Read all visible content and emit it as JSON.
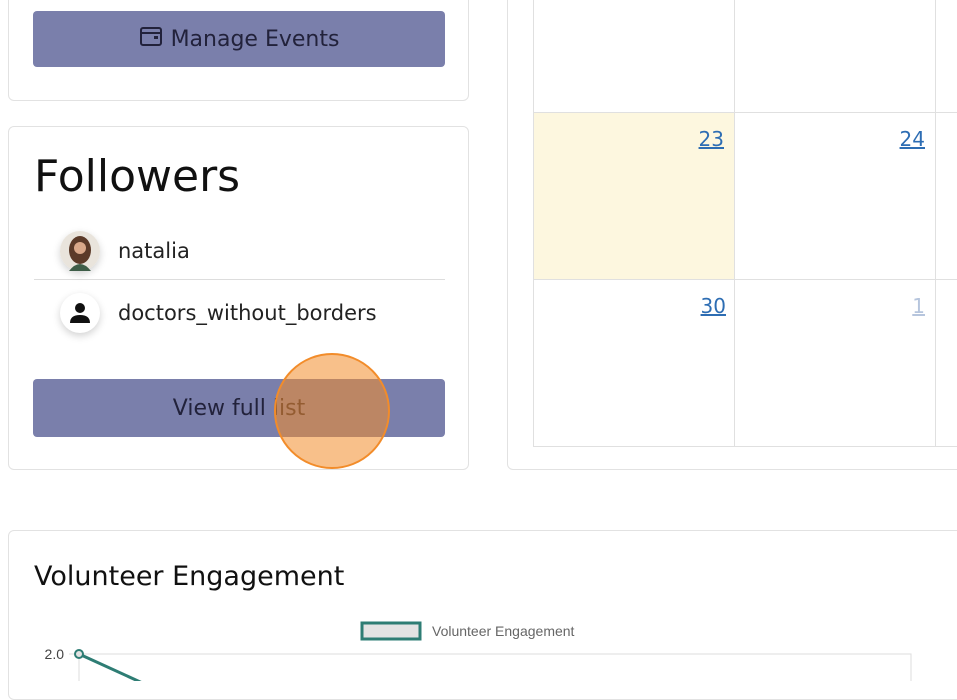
{
  "events": {
    "manage_label": "Manage Events",
    "icon": "calendar-icon"
  },
  "followers": {
    "title": "Followers",
    "items": [
      {
        "name": "natalia",
        "icon": "user-photo-avatar"
      },
      {
        "name": "doctors_without_borders",
        "icon": "person-icon"
      }
    ],
    "view_full_list_label": "View full list"
  },
  "calendar": {
    "days": [
      "23",
      "24",
      "30",
      "1"
    ],
    "highlight_color": "#fdf7df",
    "today": "23"
  },
  "chart": {
    "title": "Volunteer Engagement",
    "legend_label": "Volunteer Engagement",
    "series_color": "#2e7d74",
    "chart_data": {
      "type": "line",
      "title": "",
      "series": [
        {
          "name": "Volunteer Engagement",
          "values": [
            2.0
          ]
        }
      ],
      "y_ticks": [
        "2.0"
      ]
    }
  },
  "colors": {
    "button_bg": "#7a7fab",
    "click_indicator": "#f28c2a"
  }
}
